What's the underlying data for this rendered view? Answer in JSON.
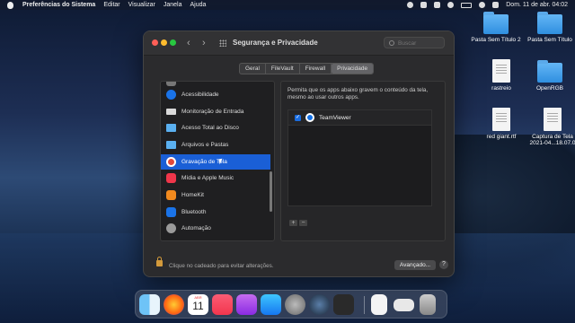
{
  "menubar": {
    "app": "Preferências do Sistema",
    "menus": [
      "Editar",
      "Visualizar",
      "Janela",
      "Ajuda"
    ],
    "clock": "Dom. 11 de abr.  04:02"
  },
  "desktop": {
    "icons": [
      {
        "label": "Pasta Sem Título 2",
        "kind": "folder"
      },
      {
        "label": "Pasta Sem Título",
        "kind": "folder"
      },
      {
        "label": "rastreio",
        "kind": "document"
      },
      {
        "label": "OpenRGB",
        "kind": "folder"
      },
      {
        "label": "red giant.rtf",
        "kind": "document"
      },
      {
        "label": "Captura de Tela 2021-04...18.07.0",
        "kind": "document"
      }
    ]
  },
  "window": {
    "title": "Segurança e Privacidade",
    "search_placeholder": "Buscar",
    "tabs": [
      {
        "label": "Geral"
      },
      {
        "label": "FileVault"
      },
      {
        "label": "Firewall"
      },
      {
        "label": "Privacidade",
        "active": true
      }
    ],
    "sidebar": {
      "items": [
        {
          "label": "Acessibilidade",
          "color": "#1a73e8"
        },
        {
          "label": "Monitoração de Entrada",
          "color": "#d9d9d9"
        },
        {
          "label": "Acesso Total ao Disco",
          "color": "#5ab0f0"
        },
        {
          "label": "Arquivos e Pastas",
          "color": "#5ab0f0"
        },
        {
          "label": "Gravação de Tela",
          "color": "#e2483a",
          "selected": true
        },
        {
          "label": "Mídia e Apple Music",
          "color": "#f0364a"
        },
        {
          "label": "HomeKit",
          "color": "#f28a1e"
        },
        {
          "label": "Bluetooth",
          "color": "#1a73e8"
        },
        {
          "label": "Automação",
          "color": "#9a9a9a"
        }
      ]
    },
    "detail": {
      "description": "Permita que os apps abaixo gravem o conteúdo da tela, mesmo ao usar outros apps.",
      "apps": [
        {
          "name": "TeamViewer",
          "checked": true
        }
      ],
      "add_label": "+",
      "remove_label": "−"
    },
    "footer": {
      "lock_text": "Clique no cadeado para evitar alterações.",
      "advanced_label": "Avançado...",
      "help_label": "?"
    }
  },
  "dock": {
    "apps": [
      "finder-icon",
      "firefox-icon",
      "calendar-icon",
      "music-icon",
      "podcasts-icon",
      "app-store-icon",
      "system-preferences-icon",
      "steam-icon",
      "teamviewer-icon",
      "document-icon",
      "preview-icon",
      "trash-icon"
    ],
    "calendar_month": "ABR",
    "calendar_day": "11"
  }
}
